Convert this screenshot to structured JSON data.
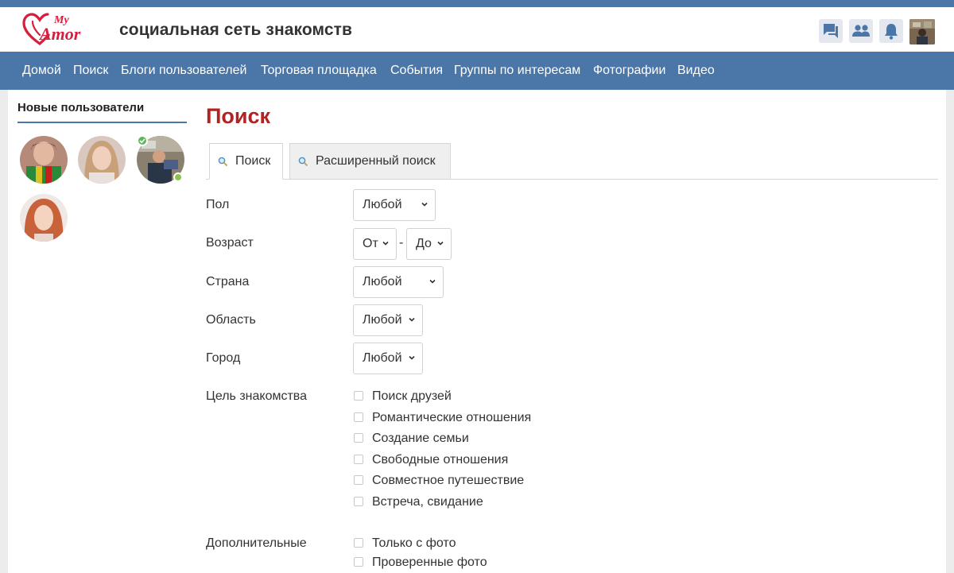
{
  "header": {
    "logo_text_my": "My",
    "logo_text_amor": "Amor",
    "site_title": "социальная сеть знакомств",
    "icons": [
      "messages-icon",
      "friends-icon",
      "notifications-icon",
      "user-avatar"
    ]
  },
  "nav": {
    "items": [
      "Домой",
      "Поиск",
      "Блоги пользователей",
      "Торговая площадка",
      "События",
      "Группы по интересам",
      "Фотографии",
      "Видео"
    ]
  },
  "sidebar": {
    "title": "Новые пользователи"
  },
  "main": {
    "title": "Поиск",
    "tabs": [
      {
        "label": "Поиск",
        "icon": "search-icon",
        "active": true
      },
      {
        "label": "Расширенный поиск",
        "icon": "search-icon",
        "active": false
      }
    ],
    "fields": {
      "gender": {
        "label": "Пол",
        "value": "Любой"
      },
      "age": {
        "label": "Возраст",
        "from": "От",
        "separator": "-",
        "to": "До"
      },
      "country": {
        "label": "Страна",
        "value": "Любой"
      },
      "region": {
        "label": "Область",
        "value": "Любой"
      },
      "city": {
        "label": "Город",
        "value": "Любой"
      },
      "goal": {
        "label": "Цель знакомства",
        "options": [
          "Поиск друзей",
          "Романтические отношения",
          "Создание семьи",
          "Свободные отношения",
          "Совместное путешествие",
          "Встреча, свидание"
        ]
      },
      "extra": {
        "label": "Дополнительные",
        "options": [
          "Только с фото",
          "Проверенные фото"
        ]
      }
    }
  },
  "colors": {
    "brand_blue": "#4a76a8",
    "title_red": "#b22222",
    "logo_red": "#d61f3c",
    "online_green": "#8cc152",
    "verified_green": "#5cb85c"
  }
}
